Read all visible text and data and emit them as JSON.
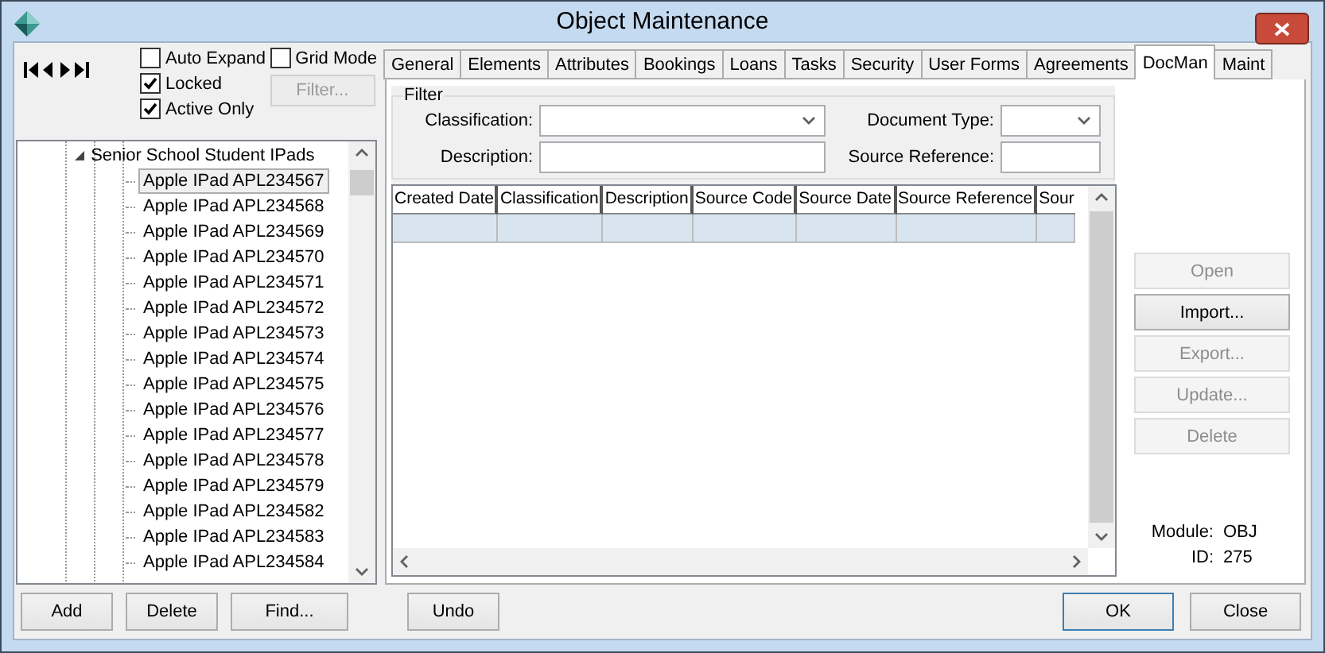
{
  "window": {
    "title": "Object Maintenance"
  },
  "options": [
    {
      "label": "Auto Expand",
      "checked": false
    },
    {
      "label": "Locked",
      "checked": true
    },
    {
      "label": "Active Only",
      "checked": true
    }
  ],
  "grid_mode": {
    "label": "Grid Mode",
    "checked": false
  },
  "filter_button": {
    "label": "Filter...",
    "disabled": true
  },
  "tree": {
    "label": "Senior School Student IPads",
    "expanded": true,
    "children": [
      {
        "label": "Apple IPad APL234567",
        "selected": true
      },
      {
        "label": "Apple IPad APL234568",
        "selected": false
      },
      {
        "label": "Apple IPad APL234569",
        "selected": false
      },
      {
        "label": "Apple IPad APL234570",
        "selected": false
      },
      {
        "label": "Apple IPad APL234571",
        "selected": false
      },
      {
        "label": "Apple IPad APL234572",
        "selected": false
      },
      {
        "label": "Apple IPad APL234573",
        "selected": false
      },
      {
        "label": "Apple IPad APL234574",
        "selected": false
      },
      {
        "label": "Apple IPad APL234575",
        "selected": false
      },
      {
        "label": "Apple IPad APL234576",
        "selected": false
      },
      {
        "label": "Apple IPad APL234577",
        "selected": false
      },
      {
        "label": "Apple IPad APL234578",
        "selected": false
      },
      {
        "label": "Apple IPad APL234579",
        "selected": false
      },
      {
        "label": "Apple IPad APL234582",
        "selected": false
      },
      {
        "label": "Apple IPad APL234583",
        "selected": false
      },
      {
        "label": "Apple IPad APL234584",
        "selected": false
      }
    ]
  },
  "left_buttons": [
    "Add",
    "Delete",
    "Find..."
  ],
  "tabs": [
    {
      "label": "General",
      "selected": false
    },
    {
      "label": "Elements",
      "selected": false
    },
    {
      "label": "Attributes",
      "selected": false
    },
    {
      "label": "Bookings",
      "selected": false
    },
    {
      "label": "Loans",
      "selected": false
    },
    {
      "label": "Tasks",
      "selected": false
    },
    {
      "label": "Security",
      "selected": false
    },
    {
      "label": "User Forms",
      "selected": false
    },
    {
      "label": "Agreements",
      "selected": false
    },
    {
      "label": "DocMan",
      "selected": true
    },
    {
      "label": "Maint",
      "selected": false
    }
  ],
  "filter": {
    "title": "Filter",
    "classification_label": "Classification:",
    "description_label": "Description:",
    "document_type_label": "Document Type:",
    "source_reference_label": "Source Reference:"
  },
  "table": {
    "columns": [
      "Created Date",
      "Classification",
      "Description",
      "Source Code",
      "Source Date",
      "Source Reference",
      "Sour"
    ]
  },
  "side_buttons": [
    {
      "label": "Open",
      "disabled": true
    },
    {
      "label": "Import...",
      "disabled": false
    },
    {
      "label": "Export...",
      "disabled": true
    },
    {
      "label": "Update...",
      "disabled": true
    },
    {
      "label": "Delete",
      "disabled": true
    }
  ],
  "info": [
    {
      "label": "Module:",
      "value": "OBJ"
    },
    {
      "label": "ID:",
      "value": "275"
    }
  ],
  "undo_button": "Undo",
  "dialog_buttons": [
    {
      "label": "OK",
      "default": true
    },
    {
      "label": "Close",
      "default": false
    }
  ]
}
